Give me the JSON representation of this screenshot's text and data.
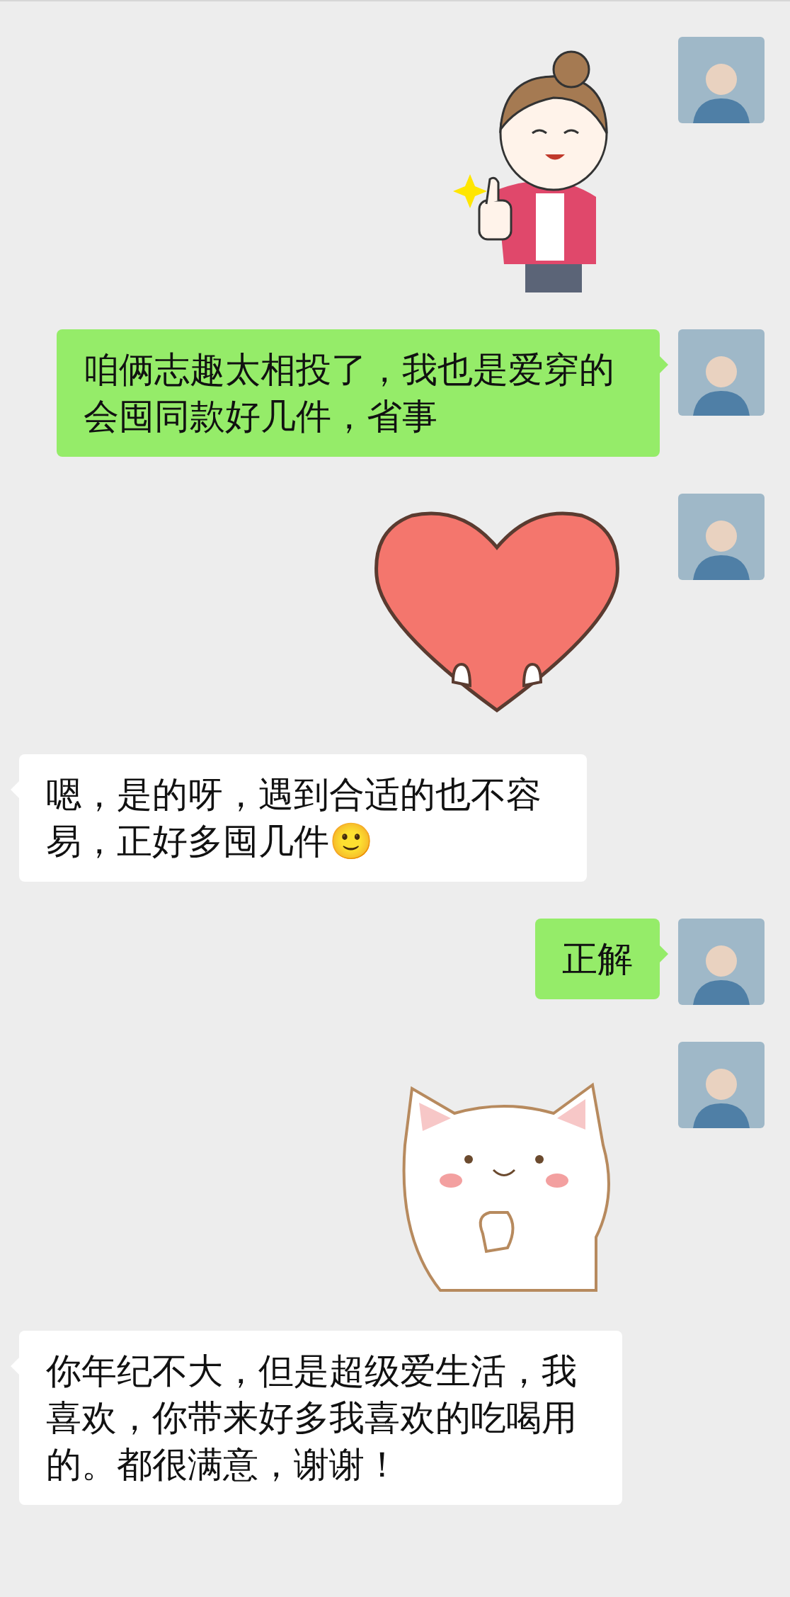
{
  "messages": [
    {
      "kind": "sticker-girl",
      "outgoing": true
    },
    {
      "kind": "text",
      "outgoing": true,
      "text": "咱俩志趣太相投了，我也是爱穿的会囤同款好几件，省事"
    },
    {
      "kind": "sticker-heart",
      "outgoing": true
    },
    {
      "kind": "text",
      "outgoing": false,
      "text": "嗯，是的呀，遇到合适的也不容易，正好多囤几件🙂"
    },
    {
      "kind": "text",
      "outgoing": true,
      "text": "正解"
    },
    {
      "kind": "sticker-cat",
      "outgoing": true
    },
    {
      "kind": "text",
      "outgoing": false,
      "text": "你年纪不大，但是超级爱生活，我喜欢，你带来好多我喜欢的吃喝用的。都很满意，谢谢！"
    }
  ]
}
